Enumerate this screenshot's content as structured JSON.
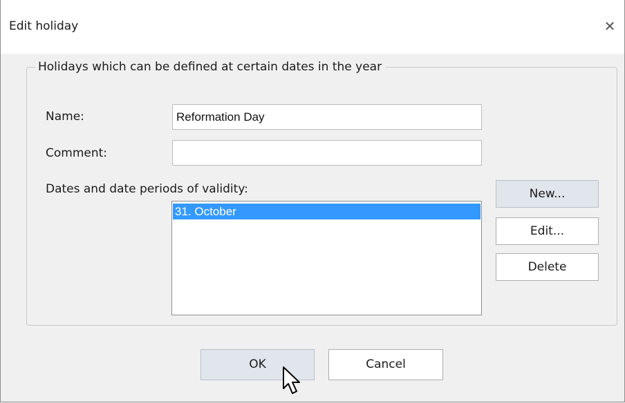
{
  "window": {
    "title": "Edit holiday",
    "close_symbol": "✕"
  },
  "group": {
    "legend": "Holidays which can be defined at certain dates in the year"
  },
  "form": {
    "name_label": "Name:",
    "name_value": "Reformation Day",
    "comment_label": "Comment:",
    "comment_value": "",
    "dates_label": "Dates and date periods of validity:",
    "dates": [
      {
        "label": "31. October",
        "selected": true
      }
    ]
  },
  "side_buttons": {
    "new_label": "New...",
    "edit_label": "Edit...",
    "delete_label": "Delete"
  },
  "footer": {
    "ok_label": "OK",
    "cancel_label": "Cancel"
  },
  "colors": {
    "selection": "#3399ff",
    "default_button": "#e1e6ec"
  },
  "icons": {
    "close": "close-icon",
    "cursor": "mouse-pointer-icon"
  }
}
